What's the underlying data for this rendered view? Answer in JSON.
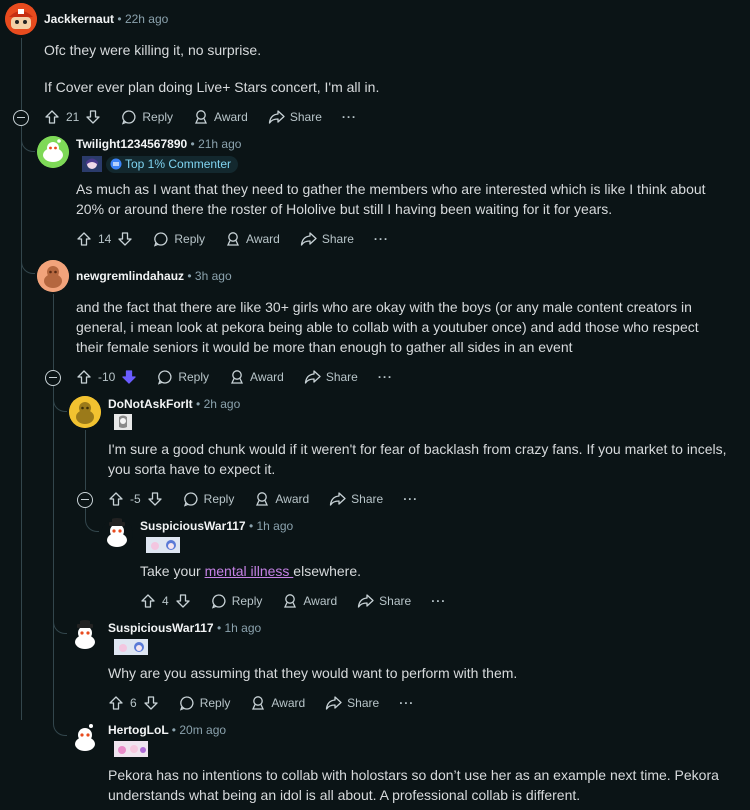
{
  "comments": [
    {
      "id": "c1",
      "username": "Jackkernaut",
      "time": "22h ago",
      "paragraphs": [
        "Ofc they were killing it, no surprise.",
        "If Cover ever plan doing Live+ Stars concert, I'm all in."
      ],
      "votes": "21",
      "reply_label": "Reply",
      "award_label": "Award",
      "share_label": "Share",
      "more_label": "···"
    },
    {
      "id": "c2",
      "username": "Twilight1234567890",
      "time": "21h ago",
      "badge": "Top 1% Commenter",
      "text": "As much as I want that they need to gather the members who are interested which is like I think about 20% or around there the roster of Hololive but still I having been waiting for it for years.",
      "votes": "14",
      "reply_label": "Reply",
      "award_label": "Award",
      "share_label": "Share",
      "more_label": "···"
    },
    {
      "id": "c3",
      "username": "newgremlindahauz",
      "time": "3h ago",
      "text": "and the fact that there are like 30+ girls who are okay with the boys (or any male content creators in general, i mean look at pekora being able to collab with a youtuber once) and add those who respect their female seniors it would be more than enough to gather all sides in an event",
      "votes": "-10",
      "reply_label": "Reply",
      "award_label": "Award",
      "share_label": "Share",
      "more_label": "···"
    },
    {
      "id": "c4",
      "username": "DoNotAskForIt",
      "time": "2h ago",
      "text": "I'm sure a good chunk would if it weren't for fear of backlash from crazy fans. If you market to incels, you sorta have to expect it.",
      "votes": "-5",
      "reply_label": "Reply",
      "award_label": "Award",
      "share_label": "Share",
      "more_label": "···"
    },
    {
      "id": "c5",
      "username": "SuspiciousWar117",
      "time": "1h ago",
      "text_before": "Take your ",
      "link_text": "mental illness ",
      "text_after": "elsewhere.",
      "votes": "4",
      "reply_label": "Reply",
      "award_label": "Award",
      "share_label": "Share",
      "more_label": "···"
    },
    {
      "id": "c6",
      "username": "SuspiciousWar117",
      "time": "1h ago",
      "text": "Why are you assuming that they would want to perform with them.",
      "votes": "6",
      "reply_label": "Reply",
      "award_label": "Award",
      "share_label": "Share",
      "more_label": "···"
    },
    {
      "id": "c7",
      "username": "HertogLoL",
      "time": "20m ago",
      "text": "Pekora has no intentions to collab with holostars so don’t use her as an example next time. Pekora understands what being an idol is all about. A professional collab is different."
    }
  ],
  "colors": {
    "background": "#0b1416",
    "downvoted": "#6a5cff",
    "link": "#c682e6",
    "badge": "#7fd3f0"
  },
  "icons": [
    "upvote-icon",
    "downvote-icon",
    "reply-icon",
    "award-icon",
    "share-icon",
    "more-icon",
    "collapse-icon",
    "badge-icon"
  ]
}
